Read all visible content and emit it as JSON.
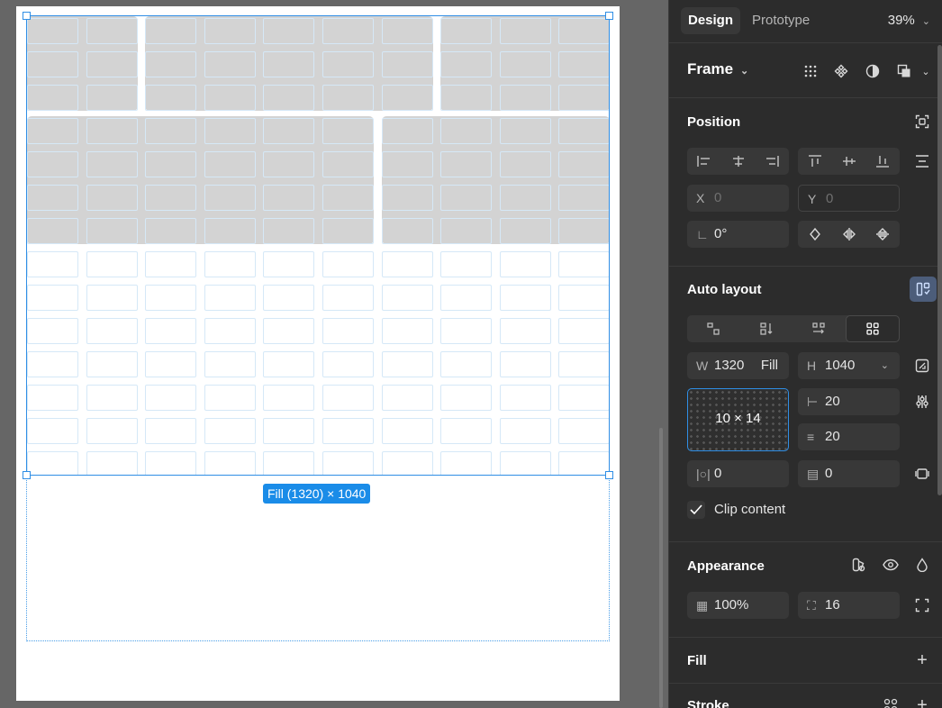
{
  "canvas": {
    "size_badge": "Fill (1320) × 1040",
    "grid": {
      "columns": 10,
      "rows": 14
    }
  },
  "panel": {
    "tabs": {
      "design": "Design",
      "prototype": "Prototype"
    },
    "zoom": "39%",
    "frame_label": "Frame",
    "position": {
      "title": "Position",
      "x_label": "X",
      "x_value": "0",
      "y_label": "Y",
      "y_value": "0",
      "rotation": "0°"
    },
    "auto_layout": {
      "title": "Auto layout",
      "w_label": "W",
      "w_value": "1320",
      "w_mode": "Fill",
      "h_label": "H",
      "h_value": "1040",
      "grid_label": "10 × 14",
      "col_gap": "20",
      "row_gap": "20",
      "padding_h": "0",
      "padding_v": "0",
      "clip_label": "Clip content"
    },
    "appearance": {
      "title": "Appearance",
      "opacity": "100%",
      "radius": "16"
    },
    "fill": {
      "title": "Fill"
    },
    "stroke": {
      "title": "Stroke"
    }
  },
  "colors": {
    "accent": "#2f8ee5",
    "panel_bg": "#2c2c2c",
    "canvas_bg": "#666666"
  }
}
